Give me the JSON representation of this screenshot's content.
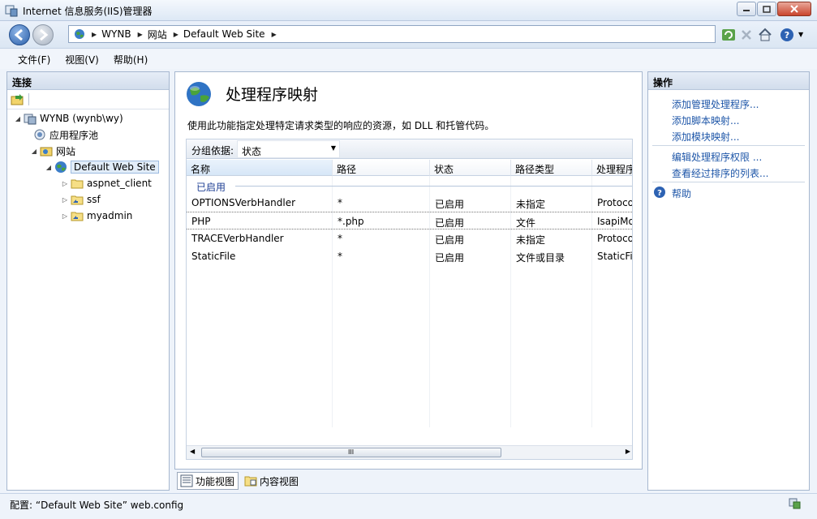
{
  "window": {
    "title": "Internet 信息服务(IIS)管理器"
  },
  "address": {
    "crumbs": [
      "WYNB",
      "网站",
      "Default Web Site"
    ]
  },
  "menu": [
    "文件(F)",
    "视图(V)",
    "帮助(H)"
  ],
  "connections": {
    "header": "连接",
    "tree": [
      {
        "label": "WYNB (wynb\\wy)"
      },
      {
        "label": "应用程序池"
      },
      {
        "label": "网站"
      },
      {
        "label": "Default Web Site"
      },
      {
        "label": "aspnet_client"
      },
      {
        "label": "ssf"
      },
      {
        "label": "myadmin"
      }
    ]
  },
  "feature": {
    "title": "处理程序映射",
    "description": "使用此功能指定处理特定请求类型的响应的资源，如 DLL 和托管代码。",
    "group_by_label": "分组依据:",
    "group_by_value": "状态",
    "columns": [
      "名称",
      "路径",
      "状态",
      "路径类型",
      "处理程序"
    ],
    "group_name": "已启用",
    "rows": [
      [
        "OPTIONSVerbHandler",
        "*",
        "已启用",
        "未指定",
        "ProtocolSupportModule"
      ],
      [
        "PHP",
        "*.php",
        "已启用",
        "文件",
        "IsapiModule"
      ],
      [
        "TRACEVerbHandler",
        "*",
        "已启用",
        "未指定",
        "ProtocolSupportModule"
      ],
      [
        "StaticFile",
        "*",
        "已启用",
        "文件或目录",
        "StaticFileModule"
      ]
    ],
    "scroll_grip": "III"
  },
  "views": {
    "features": "功能视图",
    "content": "内容视图"
  },
  "actions": {
    "header": "操作",
    "items": [
      "添加管理处理程序...",
      "添加脚本映射...",
      "添加模块映射...",
      "编辑处理程序权限 ...",
      "查看经过排序的列表...",
      "帮助"
    ]
  },
  "status": {
    "text": "配置: “Default Web Site”  web.config"
  }
}
